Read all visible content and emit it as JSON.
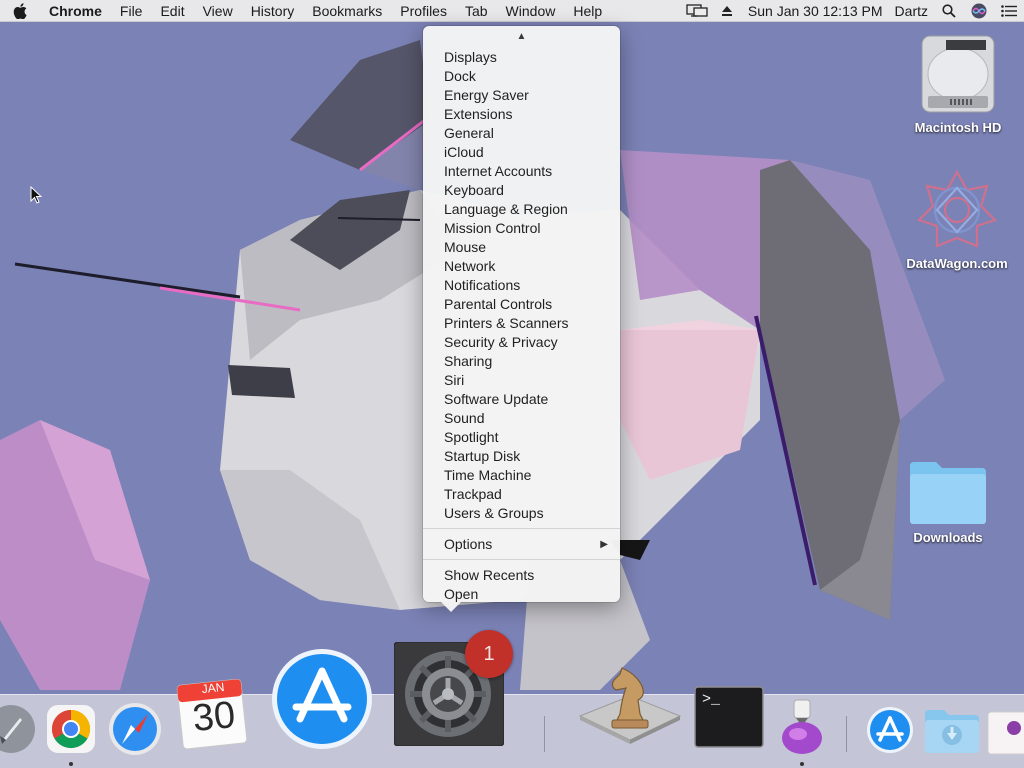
{
  "menubar": {
    "app_name": "Chrome",
    "menus": [
      "File",
      "Edit",
      "View",
      "History",
      "Bookmarks",
      "Profiles",
      "Tab",
      "Window",
      "Help"
    ],
    "clock": "Sun Jan 30  12:13 PM",
    "user": "Dartz"
  },
  "preferences_menu": {
    "panes": [
      "Displays",
      "Dock",
      "Energy Saver",
      "Extensions",
      "General",
      "iCloud",
      "Internet Accounts",
      "Keyboard",
      "Language & Region",
      "Mission Control",
      "Mouse",
      "Network",
      "Notifications",
      "Parental Controls",
      "Printers & Scanners",
      "Security & Privacy",
      "Sharing",
      "Siri",
      "Software Update",
      "Sound",
      "Spotlight",
      "Startup Disk",
      "Time Machine",
      "Trackpad",
      "Users & Groups"
    ],
    "options_label": "Options",
    "show_recents_label": "Show Recents",
    "open_label": "Open"
  },
  "desktop": {
    "hd_label": "Macintosh HD",
    "site_label": "DataWagon.com",
    "downloads_label": "Downloads"
  },
  "dock": {
    "calendar_month": "JAN",
    "calendar_day": "30",
    "prefs_badge": "1",
    "terminal_prompt": ">_"
  }
}
